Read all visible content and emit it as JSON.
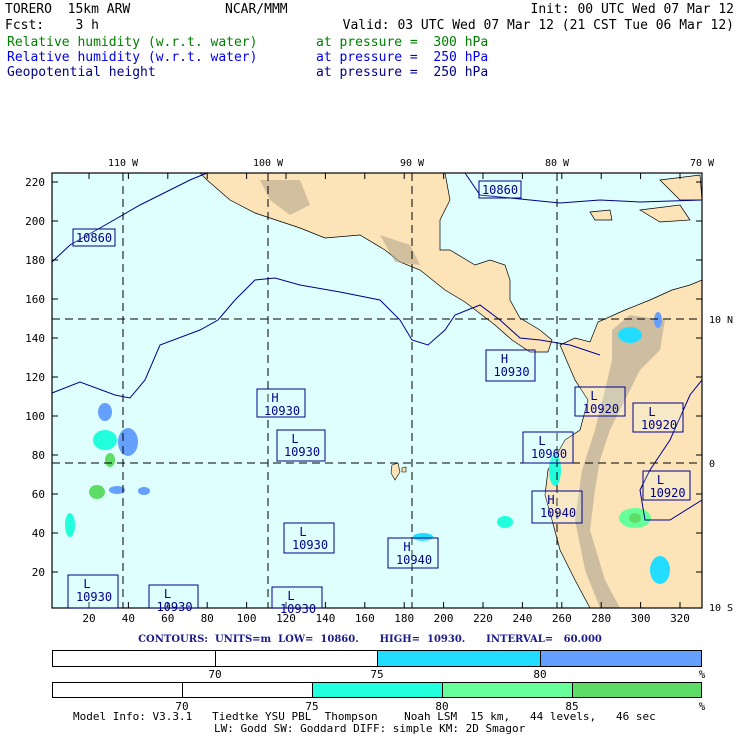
{
  "header": {
    "model": "TORERO  15km ARW",
    "org": "NCAR/MMM",
    "init": "Init: 00 UTC Wed 07 Mar 12",
    "fcst": "Fcst:    3 h",
    "valid": "Valid: 03 UTC Wed 07 Mar 12 (21 CST Tue 06 Mar 12)",
    "fields": [
      {
        "name": "Relative humidity (w.r.t. water)",
        "level": "at pressure =  300 hPa",
        "color": "#008000"
      },
      {
        "name": "Relative humidity (w.r.t. water)",
        "level": "at pressure =  250 hPa",
        "color": "#0000ee"
      },
      {
        "name": "Geopotential height",
        "level": "at pressure =  250 hPa",
        "color": "#00008b"
      }
    ]
  },
  "map": {
    "lon_labels": [
      "110 W",
      "100 W",
      "90 W",
      "80 W",
      "70 W"
    ],
    "lat_labels": [
      "10 N",
      "0",
      "10 S"
    ],
    "y_ticks": [
      "220",
      "200",
      "180",
      "160",
      "140",
      "120",
      "100",
      "80",
      "60",
      "40",
      "20"
    ],
    "x_ticks": [
      "20",
      "40",
      "60",
      "80",
      "100",
      "120",
      "140",
      "160",
      "180",
      "200",
      "220",
      "240",
      "260",
      "280",
      "300",
      "320"
    ],
    "contour_labels": [
      {
        "type": "",
        "value": "10860"
      },
      {
        "type": "",
        "value": "10860"
      },
      {
        "type": "H",
        "value": "10930"
      },
      {
        "type": "L",
        "value": "10930"
      },
      {
        "type": "H",
        "value": "10930"
      },
      {
        "type": "L",
        "value": "10920"
      },
      {
        "type": "L",
        "value": "10920"
      },
      {
        "type": "L",
        "value": "10960"
      },
      {
        "type": "L",
        "value": "10920"
      },
      {
        "type": "H",
        "value": "10940"
      },
      {
        "type": "L",
        "value": "10930"
      },
      {
        "type": "H",
        "value": "10940"
      },
      {
        "type": "L",
        "value": "10930"
      },
      {
        "type": "L",
        "value": "10930"
      },
      {
        "type": "L",
        "value": "10930"
      }
    ],
    "colors": {
      "ocean": "#dfffff",
      "land": "#fde4b8",
      "contour": "#00008b"
    }
  },
  "contours_info": "CONTOURS:  UNITS=m  LOW=  10860.      HIGH=  10930.      INTERVAL=   60.000",
  "colorbar_250": {
    "labels": [
      "70",
      "75",
      "80",
      "%"
    ],
    "colors": [
      "#ffffff",
      "#ffffff",
      "#22ddff",
      "#66a0ff"
    ]
  },
  "colorbar_300": {
    "labels": [
      "70",
      "75",
      "80",
      "85",
      "%"
    ],
    "colors": [
      "#ffffff",
      "#ffffff",
      "#22ffdd",
      "#66ff99",
      "#5ddd66"
    ]
  },
  "footer": {
    "line1": "Model Info: V3.3.1   Tiedtke YSU PBL  Thompson    Noah LSM  15 km,   44 levels,   46 sec",
    "line2": "LW: Godd SW: Goddard DIFF: simple KM: 2D Smagor"
  }
}
